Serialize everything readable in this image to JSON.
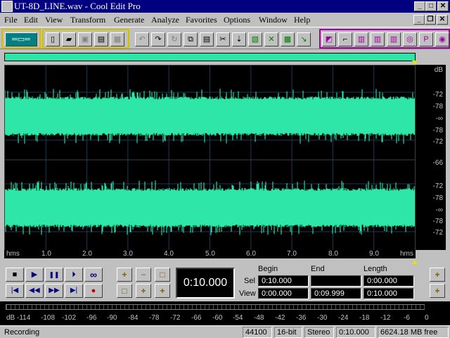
{
  "window": {
    "title": "UT-8D_LINE.wav - Cool Edit Pro",
    "controls": {
      "minimize": "_",
      "maximize": "□",
      "close": "✕"
    },
    "menu_controls": {
      "minimize": "_",
      "restore": "❐",
      "close": "✕"
    }
  },
  "menu": [
    "File",
    "Edit",
    "View",
    "Transform",
    "Generate",
    "Analyze",
    "Favorites",
    "Options",
    "Window",
    "Help"
  ],
  "toolbar": {
    "icons": [
      "multitrack-toggle-icon",
      "new-file-icon",
      "open-file-icon",
      "save-icon",
      "save-as-icon",
      "close-file-icon",
      "undo-icon",
      "redo-icon",
      "repeat-icon",
      "copy-icon",
      "paste-icon",
      "cut-icon",
      "trim-icon",
      "mix-paste-icon",
      "delete-icon",
      "zero-cross-icon",
      "spectral-icon",
      "marker-icon",
      "scripts-icon",
      "cue-list-icon",
      "play-list-icon",
      "wave-properties-icon",
      "info-icon",
      "cd-player-icon"
    ]
  },
  "waveform": {
    "color": "#2ee6a8",
    "grid_color": "#1a3a5a",
    "db_labels": [
      "dB",
      "-72",
      "-78",
      "-∞",
      "-78",
      "-72",
      "-66",
      "-72",
      "-78",
      "-∞",
      "-78",
      "-72"
    ],
    "time_labels": [
      "hms",
      "1.0",
      "2.0",
      "3.0",
      "4.0",
      "5.0",
      "6.0",
      "7.0",
      "8.0",
      "9.0",
      "hms"
    ]
  },
  "transport": {
    "stop": "■",
    "play": "▶",
    "pause": "❚❚",
    "play_to_end": "⏵",
    "loop": "∞",
    "go_start": "|◀",
    "rewind": "◀◀",
    "forward": "▶▶",
    "go_end": "▶|",
    "record": "●"
  },
  "zoom": {
    "in": "+",
    "out": "−",
    "full": "□",
    "sel": "□",
    "left": "+",
    "right": "+"
  },
  "time_display": "0:10.000",
  "selection": {
    "headers": {
      "begin": "Begin",
      "end": "End",
      "length": "Length"
    },
    "sel_label": "Sel",
    "view_label": "View",
    "sel": {
      "begin": "0:10.000",
      "end": "",
      "length": "0:00.000"
    },
    "view": {
      "begin": "0:00.000",
      "end": "0:09.999",
      "length": "0:10.000"
    }
  },
  "level_meter": {
    "scale": [
      "dB",
      "-114",
      "-108",
      "-102",
      "-96",
      "-90",
      "-84",
      "-78",
      "-72",
      "-66",
      "-60",
      "-54",
      "-48",
      "-42",
      "-36",
      "-30",
      "-24",
      "-18",
      "-12",
      "-6",
      "0"
    ]
  },
  "status": {
    "mode": "Recording",
    "sample_rate": "44100",
    "bit_depth": "16-bit",
    "channels": "Stereo",
    "duration": "0:10.000",
    "free_space": "6624.18 MB free"
  }
}
